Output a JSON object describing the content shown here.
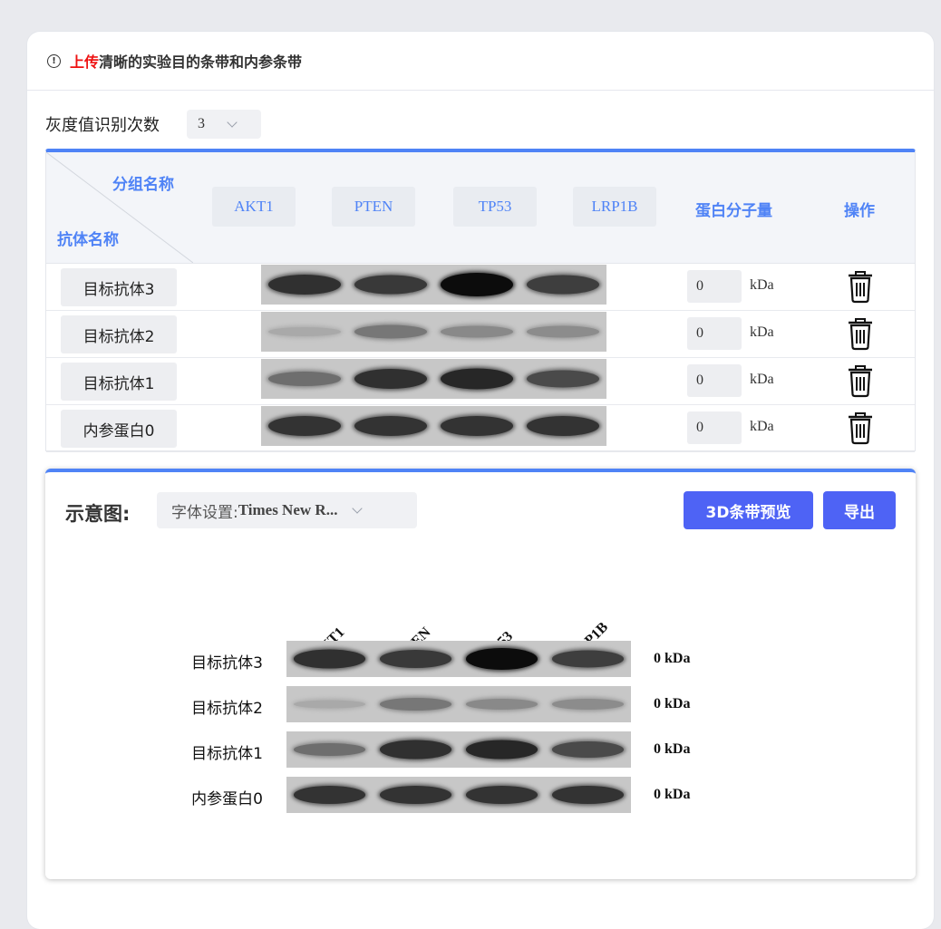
{
  "notice": {
    "icon": "info-icon",
    "highlight": "上传",
    "text": "清晰的实验目的条带和内参条带"
  },
  "gray_count": {
    "label": "灰度值识别次数",
    "value": "3"
  },
  "table": {
    "header_group": "分组名称",
    "header_antibody": "抗体名称",
    "groups": [
      "AKT1",
      "PTEN",
      "TP53",
      "LRP1B"
    ],
    "col_mw": "蛋白分子量",
    "col_op": "操作",
    "kda_unit": "kDa",
    "rows": [
      {
        "name": "目标抗体3",
        "mw": "0",
        "intensities": [
          0.8,
          0.75,
          1.0,
          0.72
        ]
      },
      {
        "name": "目标抗体2",
        "mw": "0",
        "intensities": [
          0.12,
          0.4,
          0.3,
          0.28
        ]
      },
      {
        "name": "目标抗体1",
        "mw": "0",
        "intensities": [
          0.45,
          0.8,
          0.85,
          0.65
        ]
      },
      {
        "name": "内参蛋白0",
        "mw": "0",
        "intensities": [
          0.78,
          0.78,
          0.78,
          0.78
        ]
      }
    ]
  },
  "preview": {
    "title": "示意图:",
    "font_label": "字体设置: ",
    "font_value": "Times New R...",
    "btn_3d": "3D条带预览",
    "btn_export": "导出",
    "kda_suffix": "0 kDa"
  },
  "colors": {
    "accent": "#4f83f6",
    "button": "#4e63f5",
    "highlight": "#ee1111"
  }
}
